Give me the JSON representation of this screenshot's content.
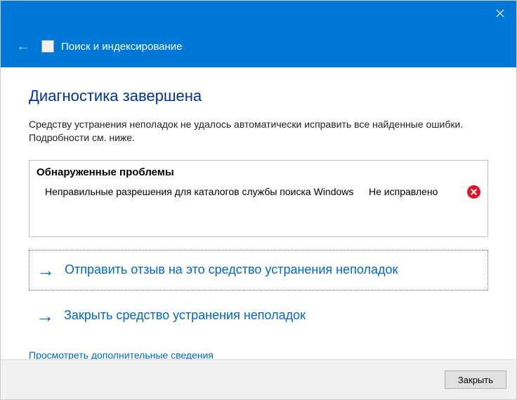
{
  "header": {
    "title": "Поиск и индексирование"
  },
  "main": {
    "heading": "Диагностика завершена",
    "subtext": "Средству устранения неполадок не удалось автоматически исправить все найденные ошибки. Подробности см. ниже."
  },
  "problems": {
    "header": "Обнаруженные проблемы",
    "items": [
      {
        "description": "Неправильные разрешения для каталогов службы поиска Windows",
        "status": "Не исправлено"
      }
    ]
  },
  "actions": {
    "feedback": "Отправить отзыв на это средство устранения неполадок",
    "close_troubleshooter": "Закрыть средство устранения неполадок",
    "details": "Просмотреть дополнительные сведения"
  },
  "footer": {
    "close_label": "Закрыть"
  }
}
